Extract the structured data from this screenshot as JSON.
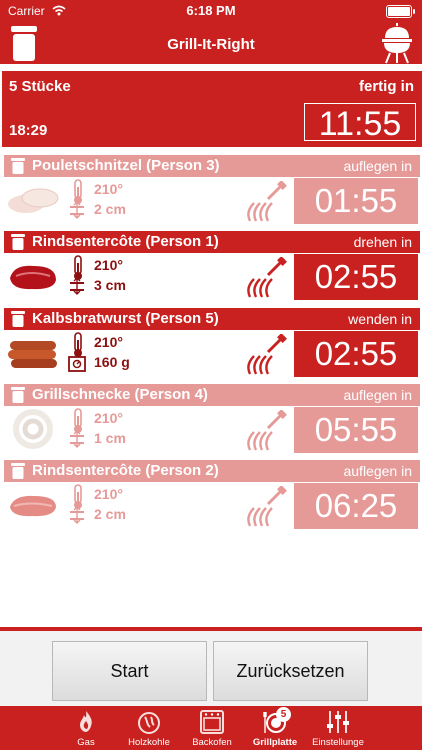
{
  "status": {
    "carrier": "Carrier",
    "time": "6:18 PM"
  },
  "nav": {
    "title": "Grill-It-Right"
  },
  "summary": {
    "count": "5 Stücke",
    "ready_label": "fertig in",
    "clock": "18:29",
    "remaining": "11:55"
  },
  "items": [
    {
      "name": "Pouletschnitzel (Person 3)",
      "action": "auflegen in",
      "temp": "210°",
      "size": "2 cm",
      "timer": "01:55",
      "style": "light",
      "food": "chicken"
    },
    {
      "name": "Rindsentercôte (Person 1)",
      "action": "drehen in",
      "temp": "210°",
      "size": "3 cm",
      "timer": "02:55",
      "style": "dark",
      "food": "beef"
    },
    {
      "name": "Kalbsbratwurst (Person 5)",
      "action": "wenden in",
      "temp": "210°",
      "size": "160 g",
      "timer": "02:55",
      "style": "dark",
      "food": "sausage"
    },
    {
      "name": "Grillschnecke (Person 4)",
      "action": "auflegen in",
      "temp": "210°",
      "size": "1 cm",
      "timer": "05:55",
      "style": "light",
      "food": "snail"
    },
    {
      "name": "Rindsentercôte (Person 2)",
      "action": "auflegen in",
      "temp": "210°",
      "size": "2 cm",
      "timer": "06:25",
      "style": "light",
      "food": "steak"
    }
  ],
  "buttons": {
    "start": "Start",
    "reset": "Zurücksetzen"
  },
  "tabs": [
    {
      "label": "Gas",
      "icon": "gas-flame-icon"
    },
    {
      "label": "Holzkohle",
      "icon": "charcoal-icon"
    },
    {
      "label": "Backofen",
      "icon": "oven-icon"
    },
    {
      "label": "Grillplatte",
      "icon": "grill-plate-icon",
      "badge": "5",
      "active": true
    },
    {
      "label": "Einstellunge",
      "icon": "settings-sliders-icon"
    }
  ],
  "colors": {
    "primary": "#c8211f",
    "light": "#e59a98",
    "dark_text": "#8c1010"
  }
}
